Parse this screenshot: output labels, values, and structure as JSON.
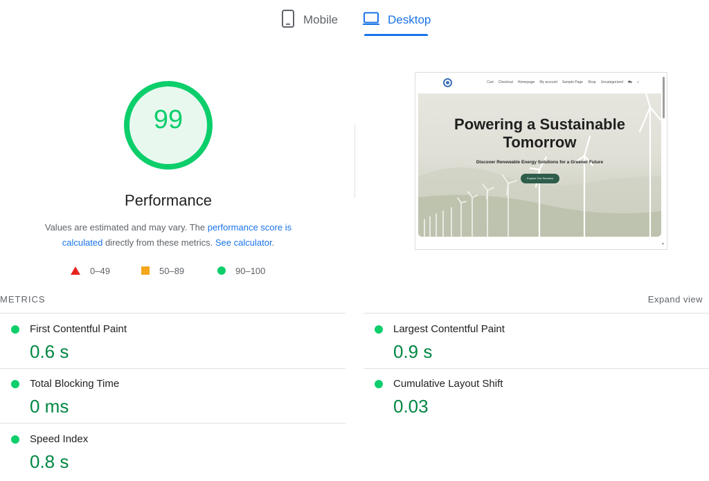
{
  "tabs": {
    "mobile": {
      "label": "Mobile",
      "icon": "smartphone-icon",
      "active": false
    },
    "desktop": {
      "label": "Desktop",
      "icon": "laptop-icon",
      "active": true
    }
  },
  "gauge": {
    "score": "99",
    "score_fraction": 0.99,
    "title": "Performance",
    "color": "#0cce6b"
  },
  "description": {
    "part1": "Values are estimated and may vary. The ",
    "link1": "performance score is calculated",
    "part2": " directly from these metrics. ",
    "link2": "See calculator",
    "part3": "."
  },
  "legend": {
    "fail": {
      "label": "0–49",
      "color": "#e8231f",
      "icon": "triangle-icon"
    },
    "average": {
      "label": "50–89",
      "color": "#f4a61c",
      "icon": "square-icon"
    },
    "pass": {
      "label": "90–100",
      "color": "#0cce6b",
      "icon": "circle-icon"
    }
  },
  "preview": {
    "menu": [
      "Cart",
      "Checkout",
      "Homepage",
      "My account",
      "Sample Page",
      "Shop",
      "Uncategorized"
    ],
    "headline": "Powering a Sustainable Tomorrow",
    "subheadline": "Discover Renewable Energy Solutions for a Greener Future",
    "button": "Explore Our Services"
  },
  "metrics_header": {
    "label": "METRICS",
    "expand": "Expand view"
  },
  "metrics": [
    {
      "name": "First Contentful Paint",
      "value": "0.6 s",
      "status": "pass"
    },
    {
      "name": "Largest Contentful Paint",
      "value": "0.9 s",
      "status": "pass"
    },
    {
      "name": "Total Blocking Time",
      "value": "0 ms",
      "status": "pass"
    },
    {
      "name": "Cumulative Layout Shift",
      "value": "0.03",
      "status": "pass"
    },
    {
      "name": "Speed Index",
      "value": "0.8 s",
      "status": "pass"
    }
  ],
  "colors": {
    "accent": "#1a73e8",
    "pass": "#0cce6b",
    "pass_text": "#018642"
  }
}
